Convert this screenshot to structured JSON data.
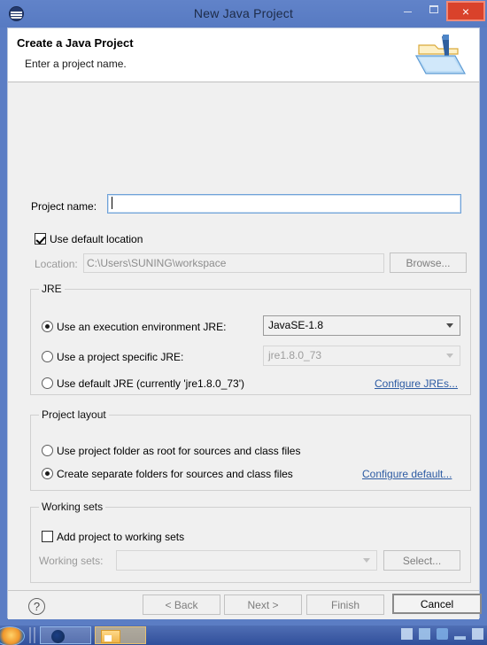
{
  "window": {
    "title": "New Java Project",
    "app_icon": "eclipse-icon",
    "controls": {
      "minimize": "minimize-icon",
      "maximize": "maximize-icon",
      "close": "×"
    }
  },
  "header": {
    "title": "Create a Java Project",
    "subtitle": "Enter a project name.",
    "icon": "java-project-folder-icon"
  },
  "form": {
    "project_name_label": "Project name:",
    "project_name_value": "",
    "use_default_location_label": "Use default location",
    "use_default_location_checked": true,
    "location_label": "Location:",
    "location_value": "C:\\Users\\SUNING\\workspace",
    "browse_label": "Browse..."
  },
  "jre": {
    "group_title": "JRE",
    "option_execution_env": "Use an execution environment JRE:",
    "execution_env_value": "JavaSE-1.8",
    "option_project_specific": "Use a project specific JRE:",
    "project_specific_value": "jre1.8.0_73",
    "option_default_jre": "Use default JRE (currently 'jre1.8.0_73')",
    "configure_link": "Configure JREs...",
    "selected": "execution_env"
  },
  "project_layout": {
    "group_title": "Project layout",
    "option_root": "Use project folder as root for sources and class files",
    "option_separate": "Create separate folders for sources and class files",
    "configure_link": "Configure default...",
    "selected": "separate"
  },
  "working_sets": {
    "group_title": "Working sets",
    "add_checkbox_label": "Add project to working sets",
    "add_checkbox_checked": false,
    "working_sets_label": "Working sets:",
    "working_sets_value": "",
    "select_label": "Select..."
  },
  "buttons": {
    "help": "?",
    "back": "< Back",
    "next": "Next >",
    "finish": "Finish",
    "cancel": "Cancel"
  },
  "colors": {
    "titlebar": "#5b7dc4",
    "close_button": "#d9422b",
    "link": "#2d5ba3",
    "body": "#f0f0f0",
    "header": "#ffffff"
  }
}
